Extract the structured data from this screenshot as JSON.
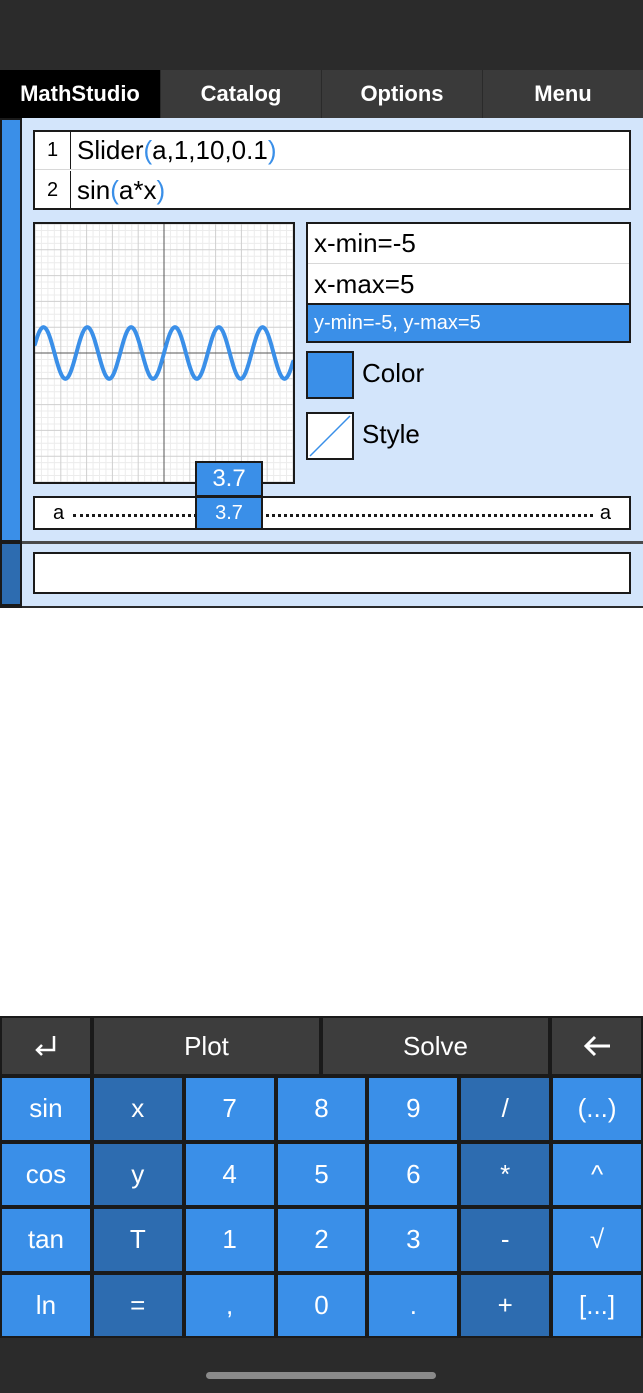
{
  "nav": {
    "title": "MathStudio",
    "tabs": [
      "Catalog",
      "Options",
      "Menu"
    ]
  },
  "code": {
    "line1": {
      "num": "1",
      "fn": "Slider",
      "args": "a,1,10,0.1"
    },
    "line2": {
      "num": "2",
      "fn": "sin",
      "args": "a*x"
    }
  },
  "plot": {
    "x_min": -5,
    "x_max": 5,
    "y_min": -5,
    "y_max": 5,
    "a": 3.7,
    "curve_color": "#3a8fe8"
  },
  "range": {
    "xmin": "x-min=-5",
    "xmax": "x-max=5",
    "y": "y-min=-5, y-max=5"
  },
  "color_label": "Color",
  "style_label": "Style",
  "slider": {
    "var": "a",
    "value": "3.7",
    "bubble": "3.7",
    "fraction": 0.3
  },
  "input": {
    "value": ""
  },
  "keyboard": {
    "top": {
      "plot": "Plot",
      "solve": "Solve"
    },
    "rows": [
      [
        "sin",
        "x",
        "7",
        "8",
        "9",
        "/",
        "(...)"
      ],
      [
        "cos",
        "y",
        "4",
        "5",
        "6",
        "*",
        "^"
      ],
      [
        "tan",
        "T",
        "1",
        "2",
        "3",
        "-",
        "√"
      ],
      [
        "ln",
        "=",
        ",",
        "0",
        ".",
        "+",
        "[...]"
      ]
    ]
  },
  "colors": {
    "accent": "#3a8fe8",
    "accent_dark": "#2d6cb0",
    "panel": "#d3e5fb"
  },
  "icons": {
    "enter": "return-icon",
    "backspace": "backspace-arrow-icon"
  }
}
